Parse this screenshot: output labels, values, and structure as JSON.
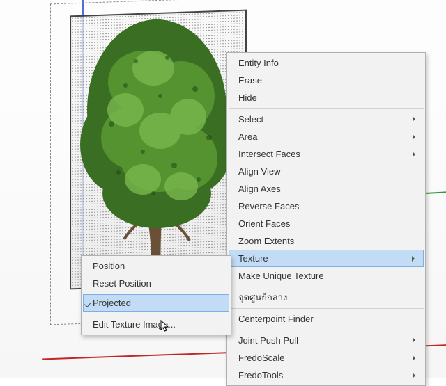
{
  "main_menu": {
    "entity_info": "Entity Info",
    "erase": "Erase",
    "hide": "Hide",
    "select": "Select",
    "area": "Area",
    "intersect_faces": "Intersect Faces",
    "align_view": "Align View",
    "align_axes": "Align Axes",
    "reverse_faces": "Reverse Faces",
    "orient_faces": "Orient Faces",
    "zoom_extents": "Zoom Extents",
    "texture": "Texture",
    "make_unique_texture": "Make Unique Texture",
    "center_thai": "จุดศูนย์กลาง",
    "centerpoint_finder": "Centerpoint Finder",
    "joint_push_pull": "Joint Push Pull",
    "fredoscale": "FredoScale",
    "fredotools": "FredoTools"
  },
  "texture_submenu": {
    "position": "Position",
    "reset_position": "Reset Position",
    "projected": "Projected",
    "edit_texture_image": "Edit Texture Image..."
  }
}
